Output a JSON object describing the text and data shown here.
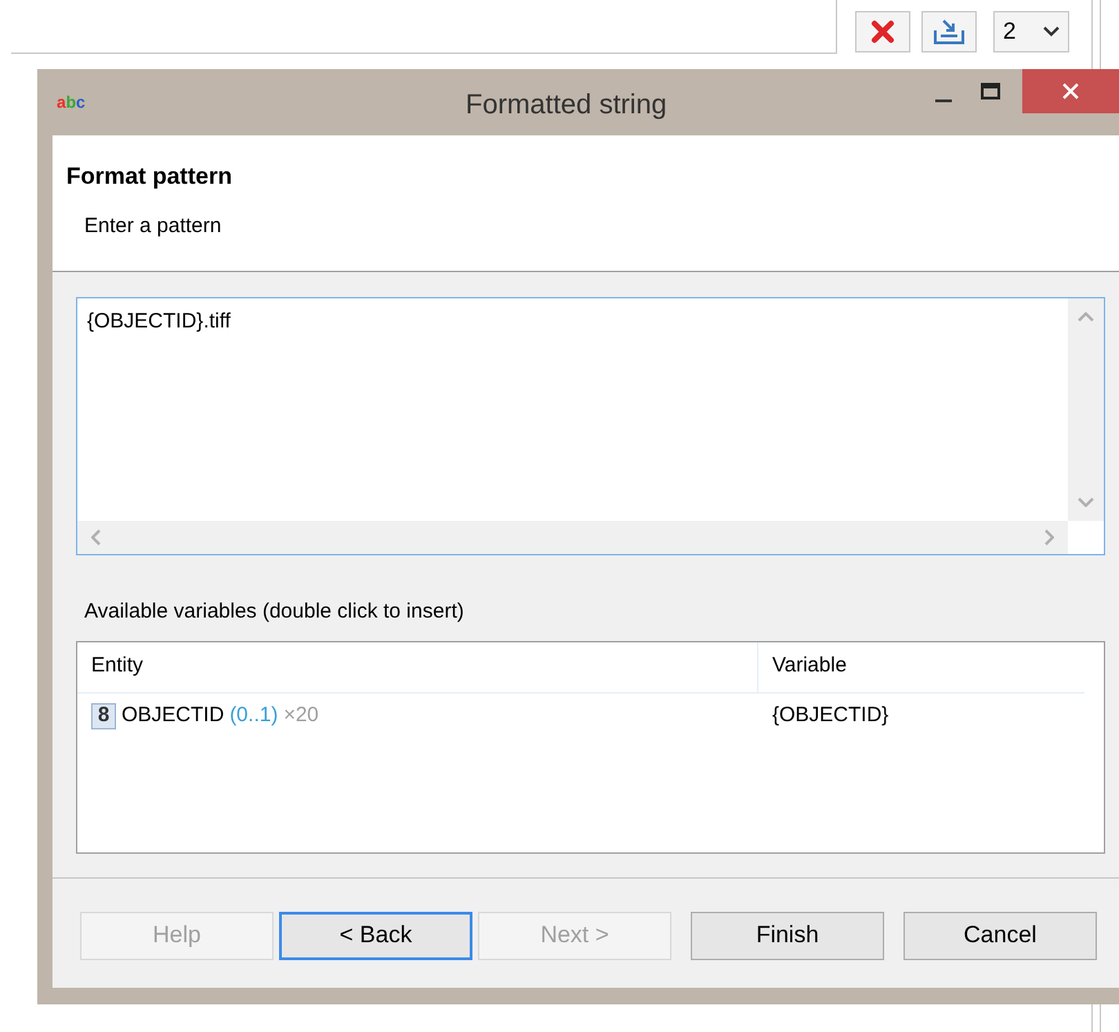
{
  "toolbar": {
    "dropdown_value": "2"
  },
  "window": {
    "title": "Formatted string",
    "icon_letters": [
      {
        "text": "a",
        "color": "#e8332a"
      },
      {
        "text": "b",
        "color": "#3aa83a"
      },
      {
        "text": "c",
        "color": "#2a5fc8"
      }
    ]
  },
  "header": {
    "title": "Format pattern",
    "subtitle": "Enter a pattern"
  },
  "pattern": {
    "value": "{OBJECTID}.tiff"
  },
  "variables": {
    "label": "Available variables (double click to insert)",
    "columns": [
      "Entity",
      "Variable"
    ],
    "rows": [
      {
        "badge": "8",
        "name": "OBJECTID",
        "range": "(0..1)",
        "count": "×20",
        "variable": "{OBJECTID}"
      }
    ]
  },
  "buttons": [
    {
      "label": "Help",
      "disabled": true,
      "focused": false
    },
    {
      "label": "< Back",
      "disabled": false,
      "focused": true
    },
    {
      "label": "Next >",
      "disabled": true,
      "focused": false
    },
    {
      "label": "Finish",
      "disabled": false,
      "focused": false
    },
    {
      "label": "Cancel",
      "disabled": false,
      "focused": false
    }
  ]
}
